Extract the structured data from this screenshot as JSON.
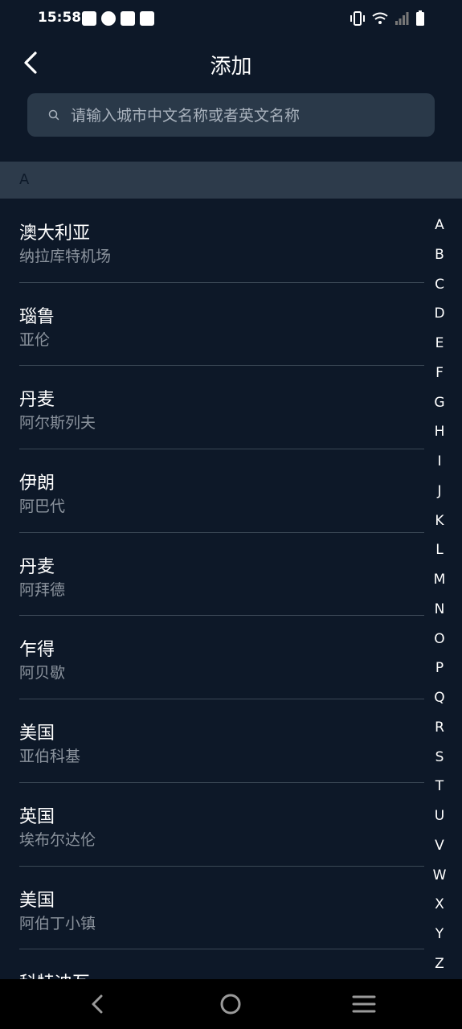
{
  "status_bar": {
    "time": "15:58",
    "left_icons": [
      "mail-icon",
      "check-circle-icon",
      "calendar-icon",
      "app-icon"
    ],
    "right_icons": [
      "vibrate-icon",
      "wifi-icon",
      "signal-icon",
      "battery-icon"
    ]
  },
  "header": {
    "title": "添加"
  },
  "search": {
    "placeholder": "请输入城市中文名称或者英文名称"
  },
  "section": {
    "letter": "A"
  },
  "cities": [
    {
      "name": "澳大利亚",
      "sub": "纳拉库特机场"
    },
    {
      "name": "瑙鲁",
      "sub": "亚伦"
    },
    {
      "name": "丹麦",
      "sub": "阿尔斯列夫"
    },
    {
      "name": "伊朗",
      "sub": "阿巴代"
    },
    {
      "name": "丹麦",
      "sub": "阿拜德"
    },
    {
      "name": "乍得",
      "sub": "阿贝歇"
    },
    {
      "name": "美国",
      "sub": "亚伯科基"
    },
    {
      "name": "英国",
      "sub": "埃布尔达伦"
    },
    {
      "name": "美国",
      "sub": "阿伯丁小镇"
    },
    {
      "name": "科特迪瓦",
      "sub": ""
    }
  ],
  "alphabet": [
    "A",
    "B",
    "C",
    "D",
    "E",
    "F",
    "G",
    "H",
    "I",
    "J",
    "K",
    "L",
    "M",
    "N",
    "O",
    "P",
    "Q",
    "R",
    "S",
    "T",
    "U",
    "V",
    "W",
    "X",
    "Y",
    "Z"
  ],
  "nav": {
    "icons": [
      "back-icon",
      "home-icon",
      "menu-icon"
    ]
  },
  "colors": {
    "background": "#0d1828",
    "search_bg": "#2a3949",
    "section_bg": "#2d3b4b",
    "subtext": "#8b939d"
  }
}
